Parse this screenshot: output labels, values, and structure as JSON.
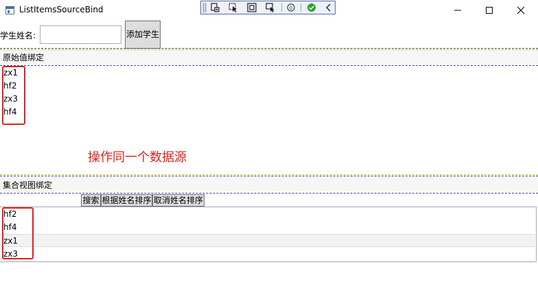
{
  "window": {
    "title": "ListItemsSourceBind",
    "controls": {
      "minimize_icon": "minimize-icon",
      "maximize_icon": "maximize-icon",
      "close_icon": "close-icon"
    }
  },
  "dev_toolbar": {
    "icons": [
      "grip-icon",
      "live-visual-tree-icon",
      "select-element-icon",
      "display-layout-adorners-icon",
      "track-focus-icon",
      "binding-failures-icon",
      "hot-reload-check-icon",
      "collapse-chevron-icon"
    ]
  },
  "form": {
    "name_label": "学生姓名:",
    "name_input_value": "",
    "name_input_placeholder": "",
    "add_button_label": "添加学生"
  },
  "raw_binding": {
    "header": "原始值绑定",
    "items": [
      "zx1",
      "hf2",
      "zx3",
      "hf4"
    ]
  },
  "annotation": "操作同一个数据源",
  "view_binding": {
    "header": "集合视图绑定",
    "buttons": {
      "search": "搜索",
      "sort_by_name": "根据姓名排序",
      "cancel_sort": "取消姓名排序"
    },
    "items": [
      "hf2",
      "hf4",
      "zx1",
      "zx3"
    ],
    "selected_index": 2
  },
  "colors": {
    "annotation_red": "#e0221c",
    "button_bg": "#dddddd",
    "dashed_blue": "#3a3aa8",
    "dashed_yellow": "#d4c200"
  }
}
